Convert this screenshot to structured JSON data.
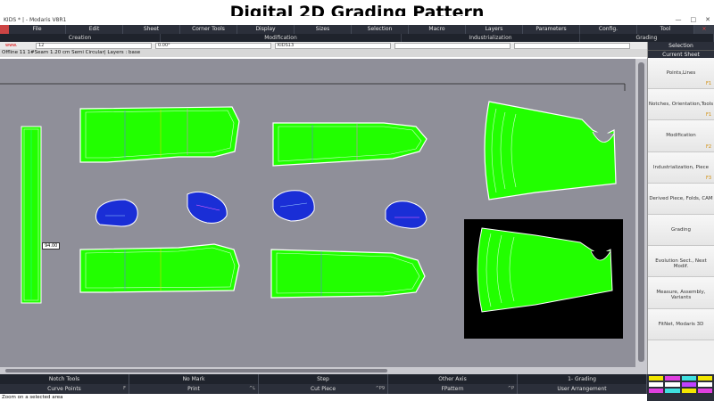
{
  "overlay_title": "Digital 2D Grading Pattern",
  "window": {
    "title": "KIDS * | - Modaris V8R1",
    "controls": [
      "—",
      "□",
      "✕"
    ]
  },
  "menu": [
    "File",
    "Edit",
    "Sheet",
    "Corner Tools",
    "Display",
    "Sizes",
    "Selection",
    "Macro",
    "Layers",
    "Parameters",
    "Config.",
    "Tool"
  ],
  "modes": [
    "Creation",
    "Modification",
    "Industrialization",
    "Grading"
  ],
  "fields": {
    "red_label": "www.",
    "size_value": "12",
    "angle_value": "0.00°",
    "sheet_value": "KIDS13"
  },
  "info_line": "Offline 11 1#Seam 1.20 cm Semi Circular|  Layers : base",
  "measure_label": "94.00",
  "bottom_row1": [
    {
      "label": "Notch Tools",
      "key": ""
    },
    {
      "label": "No Mark",
      "key": ""
    },
    {
      "label": "Step",
      "key": ""
    },
    {
      "label": "Other Axis",
      "key": ""
    },
    {
      "label": "1- Grading",
      "key": ""
    }
  ],
  "bottom_row2": [
    {
      "label": "Curve Points",
      "key": "F"
    },
    {
      "label": "Print",
      "key": "^L"
    },
    {
      "label": "Cut Piece",
      "key": "^P9"
    },
    {
      "label": "FPattern",
      "key": "^P"
    },
    {
      "label": "User Arrangement",
      "key": ""
    }
  ],
  "status": "Zoom on a selected area",
  "right_panel": {
    "selection_tab": "Selection",
    "current_tab": "Current Sheet",
    "sheets": [
      {
        "label": "Points,Lines",
        "key": "F1"
      },
      {
        "label": "Notches, Orientation,Tools",
        "key": "F1"
      },
      {
        "label": "Modification",
        "key": "F2"
      },
      {
        "label": "Industrialization, Piece",
        "key": "F3"
      },
      {
        "label": "Derived Piece, Folds, CAM",
        "key": ""
      },
      {
        "label": "Grading",
        "key": ""
      },
      {
        "label": "Evolution Sect., Next Modif.",
        "key": ""
      },
      {
        "label": "Measure, Assembly, Variants",
        "key": ""
      },
      {
        "label": "FitNet, Modaris 3D",
        "key": ""
      }
    ]
  },
  "colors": {
    "canvas": "#8f8f99",
    "pattern_fill": "#22ff00",
    "small_piece_fill": "#1a2ed6",
    "preview_bg": "#000000",
    "chrome": "#2b2f3a"
  }
}
